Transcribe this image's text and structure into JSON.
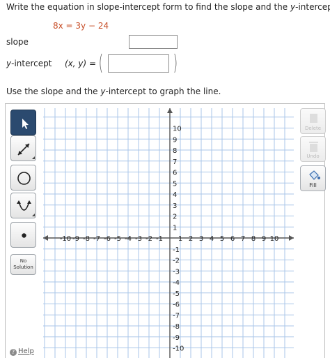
{
  "question": {
    "part1": "Write the equation in slope-intercept form to find the slope and the ",
    "var_y": "y",
    "part2": "-intercept."
  },
  "equation": "8x = 3y − 24",
  "slope_label": "slope",
  "yintercept": {
    "var_y": "y",
    "label_rest": "-intercept",
    "xy_label": "(x, y)  ="
  },
  "instruction": {
    "part1": "Use the slope and the ",
    "var_y": "y",
    "part2": "-intercept to graph the line."
  },
  "tools": {
    "select": "pointer-arrow-icon",
    "line": "line-ray-icon",
    "circle": "circle-icon",
    "parabola": "parabola-icon",
    "point": "point-icon",
    "no_solution_line1": "No",
    "no_solution_line2": "Solution",
    "help": "Help"
  },
  "right_tools": {
    "delete": "Delete",
    "undo": "Undo",
    "fill": "Fill"
  },
  "colors": {
    "selected_tool": "#2b4a6f",
    "grid": "#a9c6e8",
    "equation": "#c8502a"
  },
  "graph": {
    "x_min": -10,
    "x_max": 10,
    "y_min": -10,
    "y_max": 10,
    "x_ticks": [
      "-10",
      "-9",
      "-8",
      "-7",
      "-6",
      "-5",
      "-4",
      "-3",
      "-2",
      "-1",
      "1",
      "2",
      "3",
      "4",
      "5",
      "6",
      "7",
      "8",
      "9",
      "10"
    ],
    "y_ticks": [
      "10",
      "9",
      "8",
      "7",
      "6",
      "5",
      "4",
      "3",
      "2",
      "1",
      "-1",
      "-2",
      "-3",
      "-4",
      "-5",
      "-6",
      "-7",
      "-8",
      "-9",
      "-10"
    ]
  }
}
